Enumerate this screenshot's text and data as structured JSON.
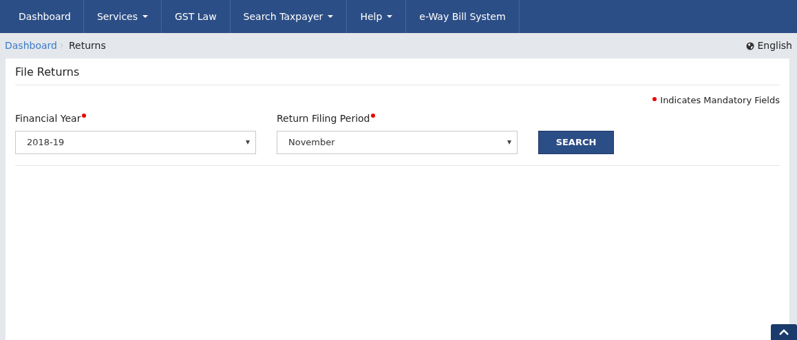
{
  "navbar": {
    "items": [
      {
        "label": "Dashboard",
        "dropdown": false
      },
      {
        "label": "Services",
        "dropdown": true
      },
      {
        "label": "GST Law",
        "dropdown": false
      },
      {
        "label": "Search Taxpayer",
        "dropdown": true
      },
      {
        "label": "Help",
        "dropdown": true
      },
      {
        "label": "e-Way Bill System",
        "dropdown": false
      }
    ]
  },
  "breadcrumb": [
    {
      "label": "Dashboard",
      "link": true
    },
    {
      "label": "Returns",
      "link": false
    }
  ],
  "language": "English",
  "panel": {
    "title": "File Returns",
    "mandatory_note": "Indicates Mandatory Fields",
    "fields": [
      {
        "label": "Financial Year",
        "required": true,
        "value": "2018-19"
      },
      {
        "label": "Return Filing Period",
        "required": true,
        "value": "November"
      }
    ],
    "button": "SEARCH"
  }
}
